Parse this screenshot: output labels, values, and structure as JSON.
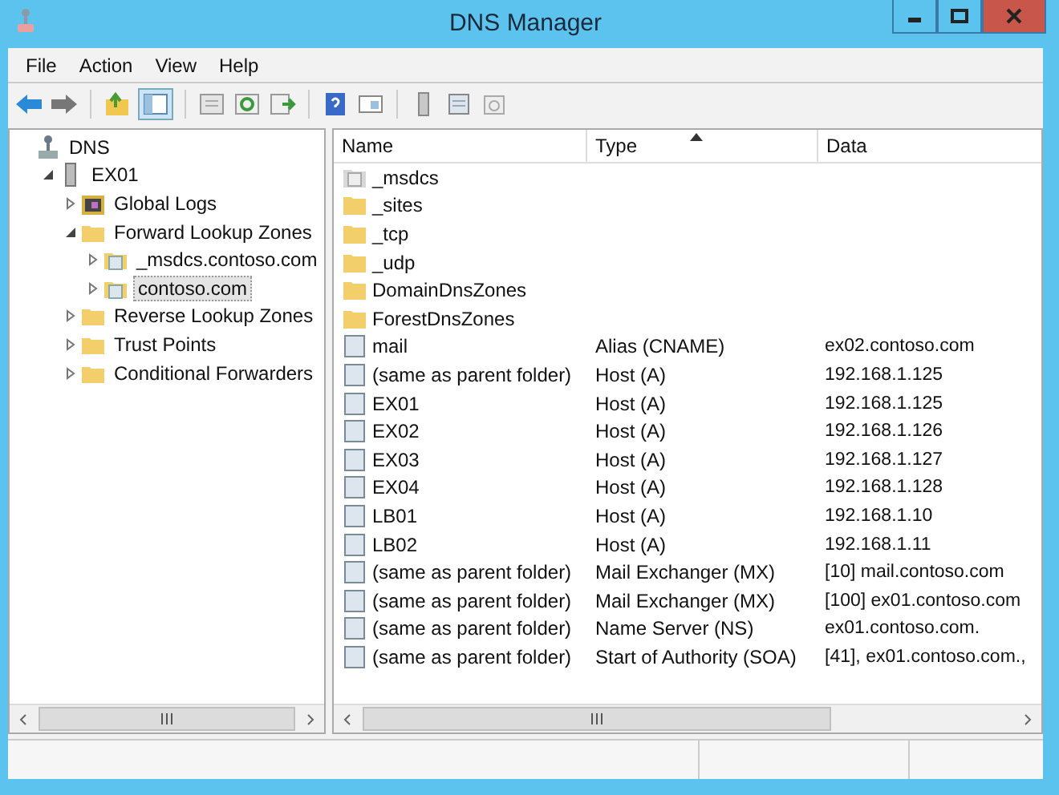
{
  "window": {
    "title": "DNS Manager"
  },
  "menu": [
    "File",
    "Action",
    "View",
    "Help"
  ],
  "tree": [
    {
      "label": "DNS",
      "kind": "dns",
      "selected": false,
      "children": [
        {
          "label": "EX01",
          "kind": "server",
          "expanded": true,
          "selected": false,
          "children": [
            {
              "label": "Global Logs",
              "kind": "logs",
              "expanded": false,
              "selected": false
            },
            {
              "label": "Forward Lookup Zones",
              "kind": "folder",
              "expanded": true,
              "selected": false,
              "children": [
                {
                  "label": "_msdcs.contoso.com",
                  "kind": "zone",
                  "expanded": false,
                  "selected": false
                },
                {
                  "label": "contoso.com",
                  "kind": "zone",
                  "expanded": false,
                  "selected": true
                }
              ]
            },
            {
              "label": "Reverse Lookup Zones",
              "kind": "folder",
              "expanded": false,
              "selected": false
            },
            {
              "label": "Trust Points",
              "kind": "folder",
              "expanded": false,
              "selected": false
            },
            {
              "label": "Conditional Forwarders",
              "kind": "folder",
              "expanded": false,
              "selected": false
            }
          ]
        }
      ]
    }
  ],
  "table": {
    "columns": [
      {
        "label": "Name",
        "sorted": false
      },
      {
        "label": "Type",
        "sorted": true
      },
      {
        "label": "Data",
        "sorted": false
      }
    ],
    "rows": [
      {
        "kind": "zone",
        "name": "_msdcs"
      },
      {
        "kind": "folder",
        "name": "_sites"
      },
      {
        "kind": "folder",
        "name": "_tcp"
      },
      {
        "kind": "folder",
        "name": "_udp"
      },
      {
        "kind": "folder",
        "name": "DomainDnsZones"
      },
      {
        "kind": "folder",
        "name": "ForestDnsZones"
      },
      {
        "kind": "record",
        "name": "mail",
        "type": "Alias (CNAME)",
        "data": "ex02.contoso.com"
      },
      {
        "kind": "record",
        "name": "(same as parent folder)",
        "type": "Host (A)",
        "data": "192.168.1.125"
      },
      {
        "kind": "record",
        "name": "EX01",
        "type": "Host (A)",
        "data": "192.168.1.125"
      },
      {
        "kind": "record",
        "name": "EX02",
        "type": "Host (A)",
        "data": "192.168.1.126"
      },
      {
        "kind": "record",
        "name": "EX03",
        "type": "Host (A)",
        "data": "192.168.1.127"
      },
      {
        "kind": "record",
        "name": "EX04",
        "type": "Host (A)",
        "data": "192.168.1.128"
      },
      {
        "kind": "record",
        "name": "LB01",
        "type": "Host (A)",
        "data": "192.168.1.10"
      },
      {
        "kind": "record",
        "name": "LB02",
        "type": "Host (A)",
        "data": "192.168.1.11"
      },
      {
        "kind": "record",
        "name": "(same as parent folder)",
        "type": "Mail Exchanger (MX)",
        "data": "[10]  mail.contoso.com"
      },
      {
        "kind": "record",
        "name": "(same as parent folder)",
        "type": "Mail Exchanger (MX)",
        "data": "[100]  ex01.contoso.com"
      },
      {
        "kind": "record",
        "name": "(same as parent folder)",
        "type": "Name Server (NS)",
        "data": "ex01.contoso.com."
      },
      {
        "kind": "record",
        "name": "(same as parent folder)",
        "type": "Start of Authority (SOA)",
        "data": "[41], ex01.contoso.com.,"
      }
    ]
  }
}
